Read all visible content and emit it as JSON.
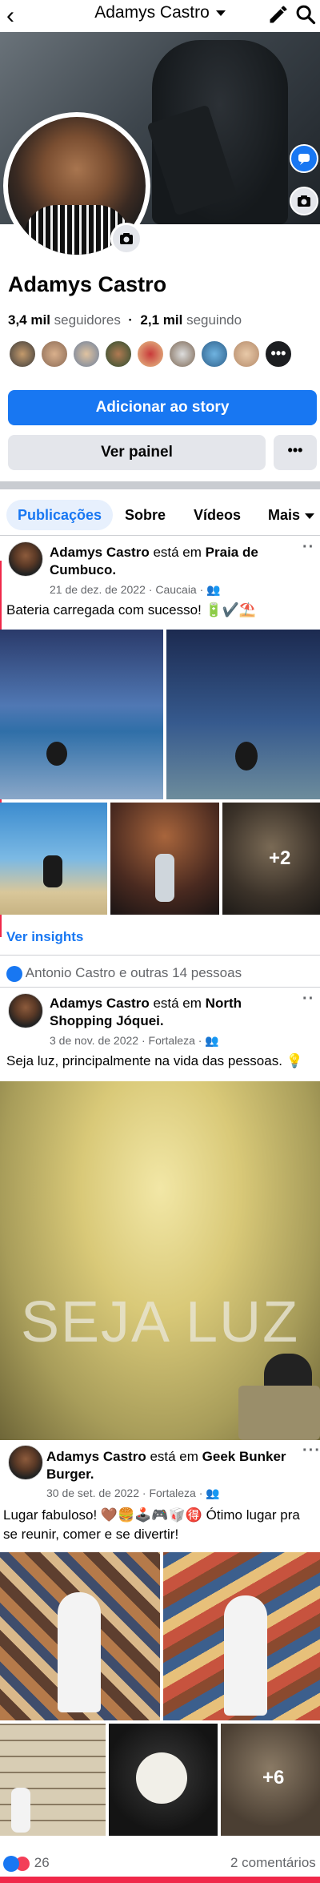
{
  "header": {
    "title": "Adamys Castro",
    "back_icon": "chevron-left-icon",
    "edit_icon": "pencil-icon",
    "search_icon": "search-icon"
  },
  "profile": {
    "name": "Adamys Castro",
    "followers_count": "3,4 mil",
    "followers_label": "seguidores",
    "separator": "·",
    "following_count": "2,1 mil",
    "following_label": "seguindo",
    "more_friends": "•••"
  },
  "actions": {
    "add_story": "Adicionar ao story",
    "view_panel": "Ver painel",
    "more": "•••"
  },
  "tabs": [
    {
      "label": "Publicações",
      "active": true
    },
    {
      "label": "Sobre"
    },
    {
      "label": "Vídeos"
    },
    {
      "label": "Mais"
    }
  ],
  "posts": [
    {
      "author": "Adamys Castro",
      "verb": "está em",
      "place": "Praia de Cumbuco",
      "date": "21 de dez. de 2022",
      "location": "Caucaia",
      "text": "Bateria carregada com sucesso! 🔋✔️⛱️",
      "more_photos": "+2",
      "insights": "Ver insights",
      "reactions": "Antonio Castro e outras 14 pessoas"
    },
    {
      "author": "Adamys Castro",
      "verb": "está em",
      "place": "North Shopping Jóquei",
      "date": "3 de nov. de 2022",
      "location": "Fortaleza",
      "text": "Seja luz, principalmente na vida das pessoas. 💡",
      "sign_text": "SEJA LUZ"
    },
    {
      "author": "Adamys Castro",
      "verb": "está em",
      "place": "Geek Bunker Burger",
      "date": "30 de set. de 2022",
      "location": "Fortaleza",
      "text_line1": "Lugar fabuloso! 🤎🍔🕹️🎮🥡🉐 Ótimo lugar pra",
      "text_line2": "se reunir, comer e se divertir!",
      "more_photos": "+6",
      "reaction_count": "26",
      "comments": "2 comentários"
    }
  ],
  "colors": {
    "accent": "#1877f2",
    "secondary_button": "#e4e6eb",
    "muted_text": "#65676b"
  }
}
